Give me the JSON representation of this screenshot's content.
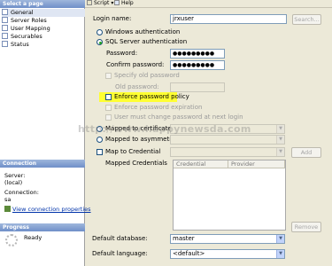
{
  "left_pane": {
    "select_page_header": "Select a page",
    "pages": [
      {
        "label": "General",
        "selected": true
      },
      {
        "label": "Server Roles",
        "selected": false
      },
      {
        "label": "User Mapping",
        "selected": false
      },
      {
        "label": "Securables",
        "selected": false
      },
      {
        "label": "Status",
        "selected": false
      }
    ],
    "connection_header": "Connection",
    "server_label": "Server:",
    "server_value": "(local)",
    "connection_label": "Connection:",
    "connection_value": "sa",
    "view_connection_link": "View connection properties",
    "progress_header": "Progress",
    "progress_status": "Ready"
  },
  "toolbar": {
    "script_label": "Script",
    "help_label": "Help"
  },
  "form": {
    "login_name_label": "Login name:",
    "login_name_value": "jrxuser",
    "search_button": "Search...",
    "windows_auth_label": "Windows authentication",
    "sql_auth_label": "SQL Server authentication",
    "password_label": "Password:",
    "password_value": "●●●●●●●●●",
    "confirm_password_label": "Confirm password:",
    "confirm_password_value": "●●●●●●●●●",
    "specify_old_password_label": "Specify old password",
    "old_password_label": "Old password:",
    "enforce_policy_label": "Enforce password policy",
    "enforce_expiration_label": "Enforce password expiration",
    "must_change_label": "User must change password at next login",
    "mapped_certificate_label": "Mapped to certificate",
    "mapped_asym_key_label": "Mapped to asymmetric key",
    "map_credential_label": "Map to Credential",
    "add_button": "Add",
    "mapped_credentials_label": "Mapped Credentials",
    "credential_col": "Credential",
    "provider_col": "Provider",
    "remove_button": "Remove",
    "default_database_label": "Default database:",
    "default_database_value": "master",
    "default_language_label": "Default language:",
    "default_language_value": "<default>"
  },
  "watermark": "http://www.happynewsda.com",
  "colors": {
    "highlight": "#ffff33",
    "pane_header": "#6f8fc8",
    "radio_selected": "#21a121"
  }
}
